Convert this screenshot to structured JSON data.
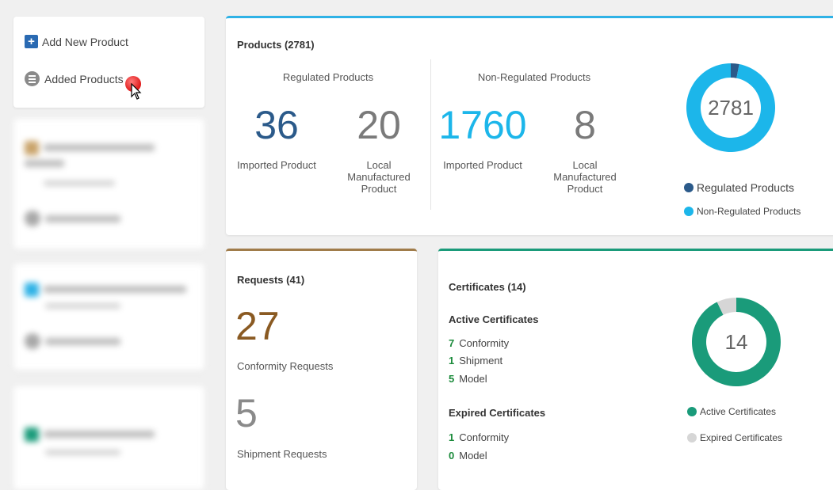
{
  "sidebar": {
    "add_new_product": "Add New Product",
    "added_products": "Added Products"
  },
  "products": {
    "title": "Products (2781)",
    "regulated": {
      "heading": "Regulated Products",
      "imported_value": "36",
      "imported_label": "Imported Product",
      "local_value": "20",
      "local_label_1": "Local",
      "local_label_2": "Manufactured",
      "local_label_3": "Product"
    },
    "non_regulated": {
      "heading": "Non-Regulated Products",
      "imported_value": "1760",
      "imported_label": "Imported Product",
      "local_value": "8",
      "local_label_1": "Local",
      "local_label_2": "Manufactured",
      "local_label_3": "Product"
    },
    "donut_total": "2781",
    "legend": [
      {
        "label": "Regulated Products",
        "color": "#2b5a8a"
      },
      {
        "label": "Non-Regulated Products",
        "color": "#1cb6ea"
      }
    ]
  },
  "requests": {
    "title": "Requests (41)",
    "conformity_value": "27",
    "conformity_label": "Conformity Requests",
    "shipment_value": "5",
    "shipment_label": "Shipment Requests"
  },
  "certificates": {
    "title": "Certificates (14)",
    "active_heading": "Active Certificates",
    "active": [
      {
        "count": "7",
        "label": "Conformity"
      },
      {
        "count": "1",
        "label": "Shipment"
      },
      {
        "count": "5",
        "label": "Model"
      }
    ],
    "expired_heading": "Expired Certificates",
    "expired": [
      {
        "count": "1",
        "label": "Conformity"
      },
      {
        "count": "0",
        "label": "Model"
      }
    ],
    "donut_total": "14",
    "legend": [
      {
        "label": "Active Certificates",
        "color": "#1a9b7a"
      },
      {
        "label": "Expired Certificates",
        "color": "#d6d6d6"
      }
    ]
  },
  "colors": {
    "regulated_accent": "#2b5a8a",
    "non_regulated_accent": "#1cb6ea",
    "requests_accent": "#a07c4a",
    "certificates_accent": "#1a9b7a"
  },
  "chart_data": [
    {
      "type": "pie",
      "title": "",
      "center_label": "2781",
      "categories": [
        "Regulated Products",
        "Non-Regulated Products"
      ],
      "values": [
        56,
        1768
      ]
    },
    {
      "type": "pie",
      "title": "",
      "center_label": "14",
      "categories": [
        "Active Certificates",
        "Expired Certificates"
      ],
      "values": [
        13,
        1
      ]
    }
  ]
}
